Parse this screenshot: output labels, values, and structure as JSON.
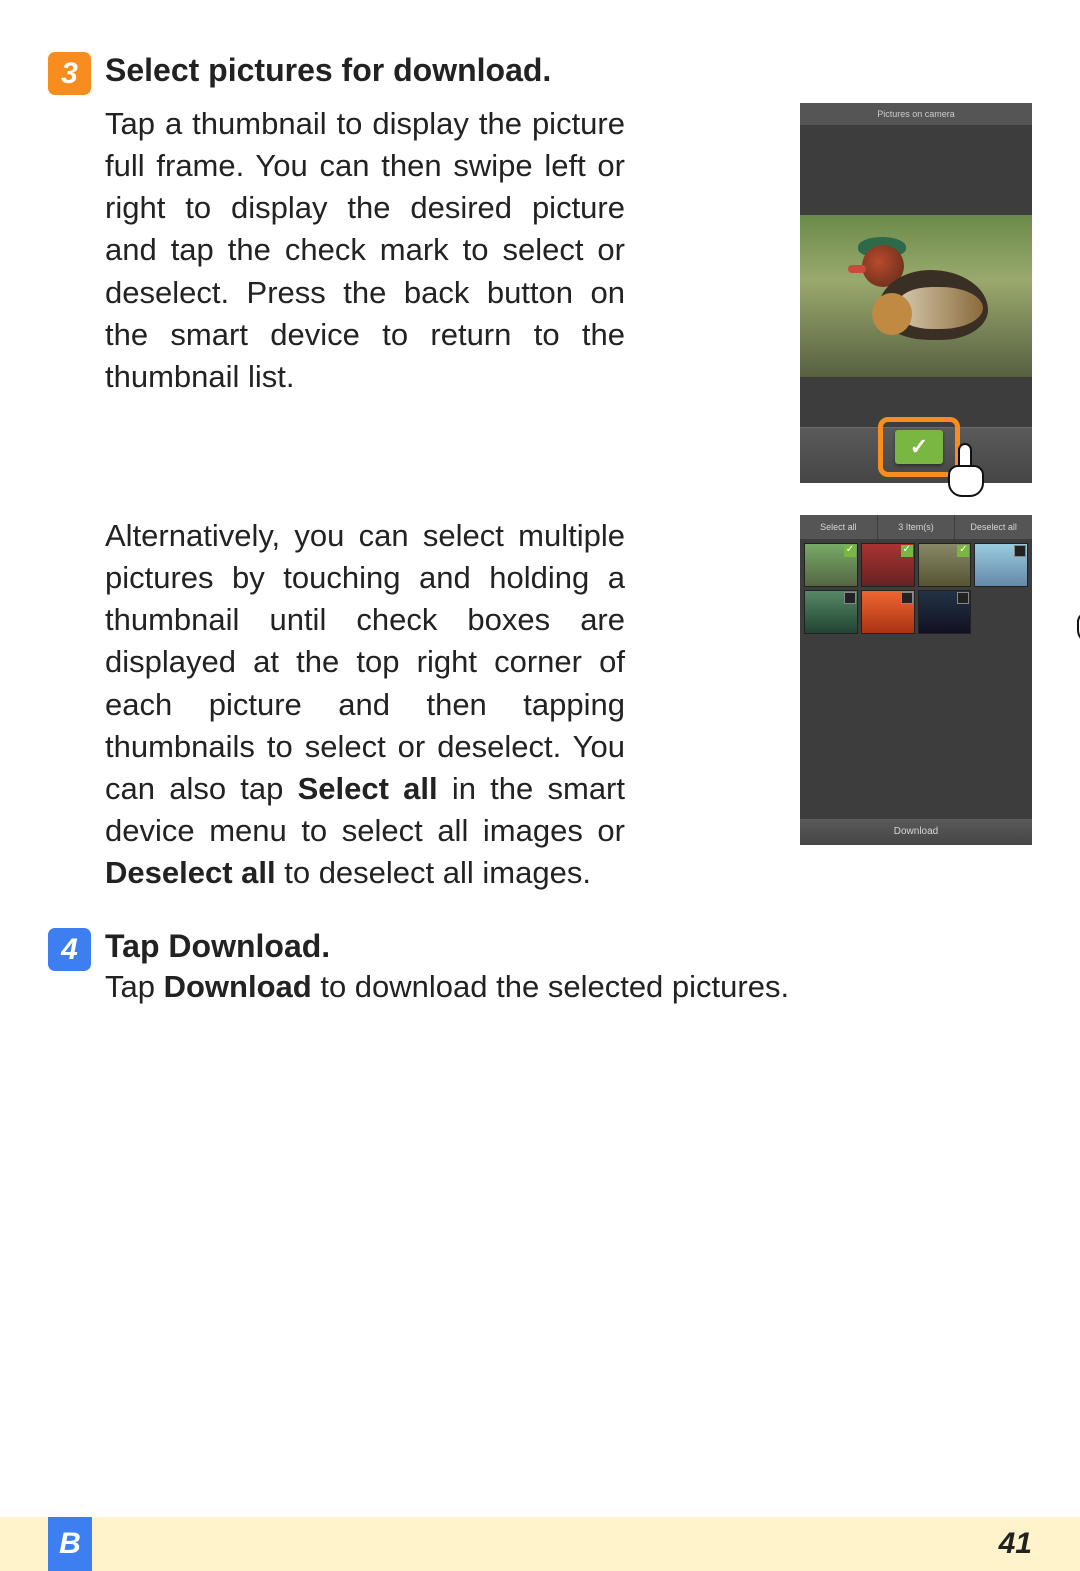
{
  "step3": {
    "number": "3",
    "title": "Select pictures for download.",
    "para1": "Tap a thumbnail to display the picture full frame. You can then swipe left or right to display the desired picture and tap the check mark to select or deselect. Press the back button on the smart device to return to the thumbnail list.",
    "para2_part1": "Alternatively, you can select multiple pictures by touching and holding a thumbnail until check boxes are displayed at the top right corner of each picture and then tapping thumbnails to select or deselect. You can also tap ",
    "para2_bold1": "Select all",
    "para2_part2": " in the smart device menu to select all images or ",
    "para2_bold2": "Deselect all",
    "para2_part3": " to deselect all images."
  },
  "phone1": {
    "title": "Pictures on camera",
    "check_glyph": "✓"
  },
  "phone2": {
    "select_all": "Select all",
    "count": "3 Item(s)",
    "deselect_all": "Deselect all",
    "download": "Download",
    "thumbs": [
      {
        "selected": true
      },
      {
        "selected": true
      },
      {
        "selected": true
      },
      {
        "selected": false
      },
      {
        "selected": false
      },
      {
        "selected": false
      },
      {
        "selected": false
      }
    ]
  },
  "step4": {
    "number": "4",
    "title_prefix": "Tap ",
    "title_bold": "Download",
    "title_suffix": ".",
    "body_prefix": "Tap ",
    "body_bold": "Download",
    "body_suffix": " to download the selected pictures."
  },
  "footer": {
    "section": "B",
    "page": "41"
  }
}
